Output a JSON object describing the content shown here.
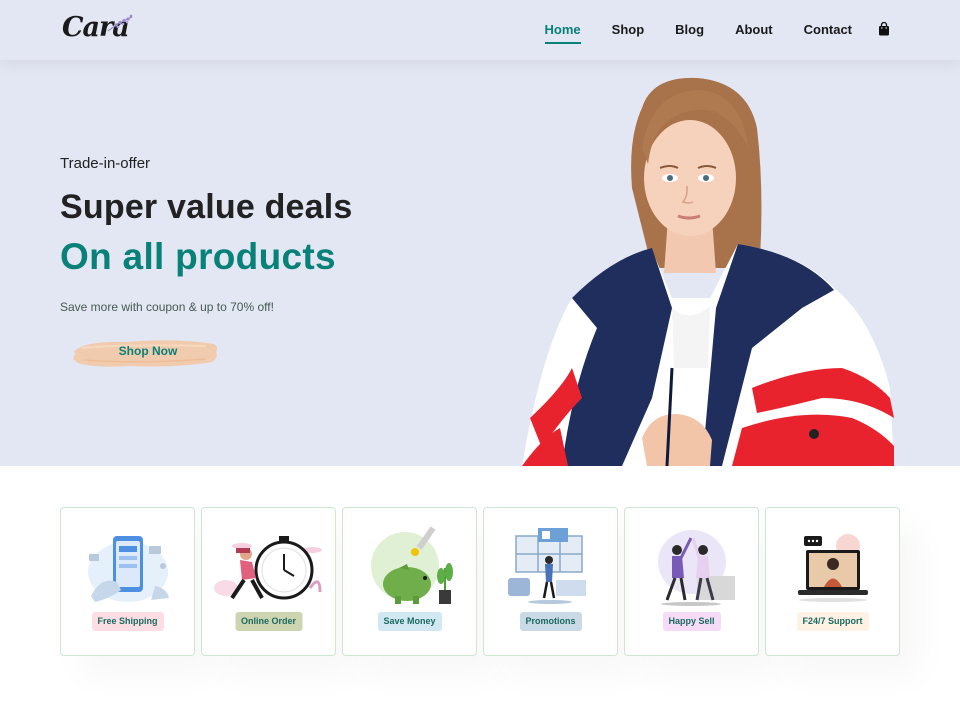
{
  "header": {
    "logo_text": "Cara",
    "nav": [
      "Home",
      "Shop",
      "Blog",
      "About",
      "Contact"
    ],
    "active": "Home",
    "accent": "#088178"
  },
  "hero": {
    "kicker": "Trade-in-offer",
    "headline": "Super value deals",
    "highlight": "On all products",
    "subtext": "Save more with coupon & up to 70% off!",
    "cta": "Shop Now",
    "background": "#e3e6f3"
  },
  "features": [
    {
      "label": "Free Shipping",
      "illustration": "phone-delivery-illustration",
      "badge_color": "#fddde4",
      "text_color": "#1a6a60"
    },
    {
      "label": "Online Order",
      "illustration": "clock-runner-illustration",
      "badge_color": "#cdebbc",
      "text_color": "#1a6a60"
    },
    {
      "label": "Save Money",
      "illustration": "piggy-bank-illustration",
      "badge_color": "#d1e8f2",
      "text_color": "#1a6a60"
    },
    {
      "label": "Promotions",
      "illustration": "promotion-window-illustration",
      "badge_color": "#cdd4f8",
      "text_color": "#1a6a60"
    },
    {
      "label": "Happy Sell",
      "illustration": "high-five-illustration",
      "badge_color": "#f6dbf6",
      "text_color": "#1a6a60"
    },
    {
      "label": "F24/7 Support",
      "illustration": "laptop-support-illustration",
      "badge_color": "#fff2e5",
      "text_color": "#1a6a60"
    }
  ]
}
